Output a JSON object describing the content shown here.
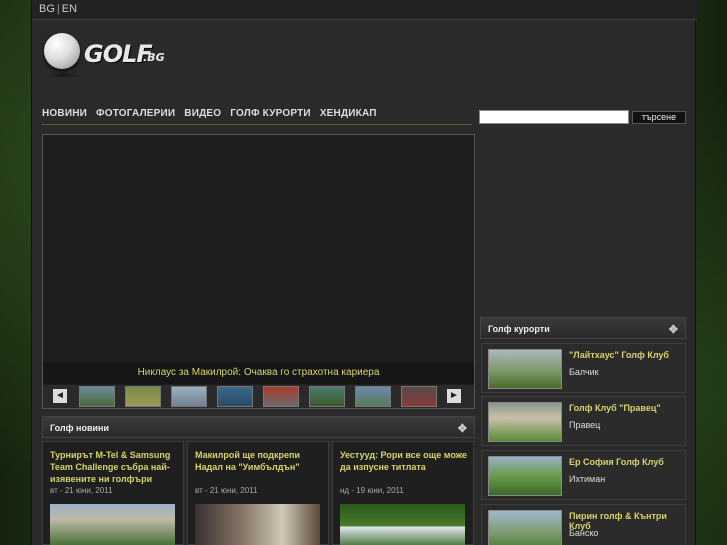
{
  "lang": {
    "bg": "BG",
    "sep": "|",
    "en": "EN"
  },
  "logo": {
    "word": "GOLF",
    "tld": ".BG"
  },
  "nav": [
    "НОВИНИ",
    "ФОТОГАЛЕРИИ",
    "ВИДЕО",
    "ГОЛФ КУРОРТИ",
    "ХЕНДИКАП"
  ],
  "search": {
    "button": "търсене",
    "value": ""
  },
  "slider": {
    "caption": "Никлаус за Макилрой: Очаква го страхотна кариера",
    "prev": "◄",
    "next": "►"
  },
  "news": {
    "header": "Голф новини",
    "move_icon": "move-icon",
    "items": [
      {
        "title": "Турнирът M-Tel & Samsung Team Challenge събра най-изявените ни голфъри",
        "date": "вт - 21 юни, 2011"
      },
      {
        "title": "Макилрой ще подкрепи Надал на \"Уимбълдън\"",
        "date": "вт - 21 юни, 2011"
      },
      {
        "title": "Уестууд: Рори все още може да изпусне титлата",
        "date": "нд - 19 юни, 2011"
      }
    ]
  },
  "resorts": {
    "header": "Голф курорти",
    "items": [
      {
        "name": "\"Лайтхаус\" Голф Клуб",
        "town": "Балчик"
      },
      {
        "name": "Голф Клуб \"Правец\"",
        "town": "Правец"
      },
      {
        "name": "Ер София Голф Клуб",
        "town": "Ихтиман"
      },
      {
        "name": "Пирин голф & Кънтри Клуб",
        "town": "Банско"
      }
    ]
  },
  "colors": {
    "accent": "#d6d46a",
    "panel": "#2a2a2a",
    "navline": "#4a6b2b"
  }
}
